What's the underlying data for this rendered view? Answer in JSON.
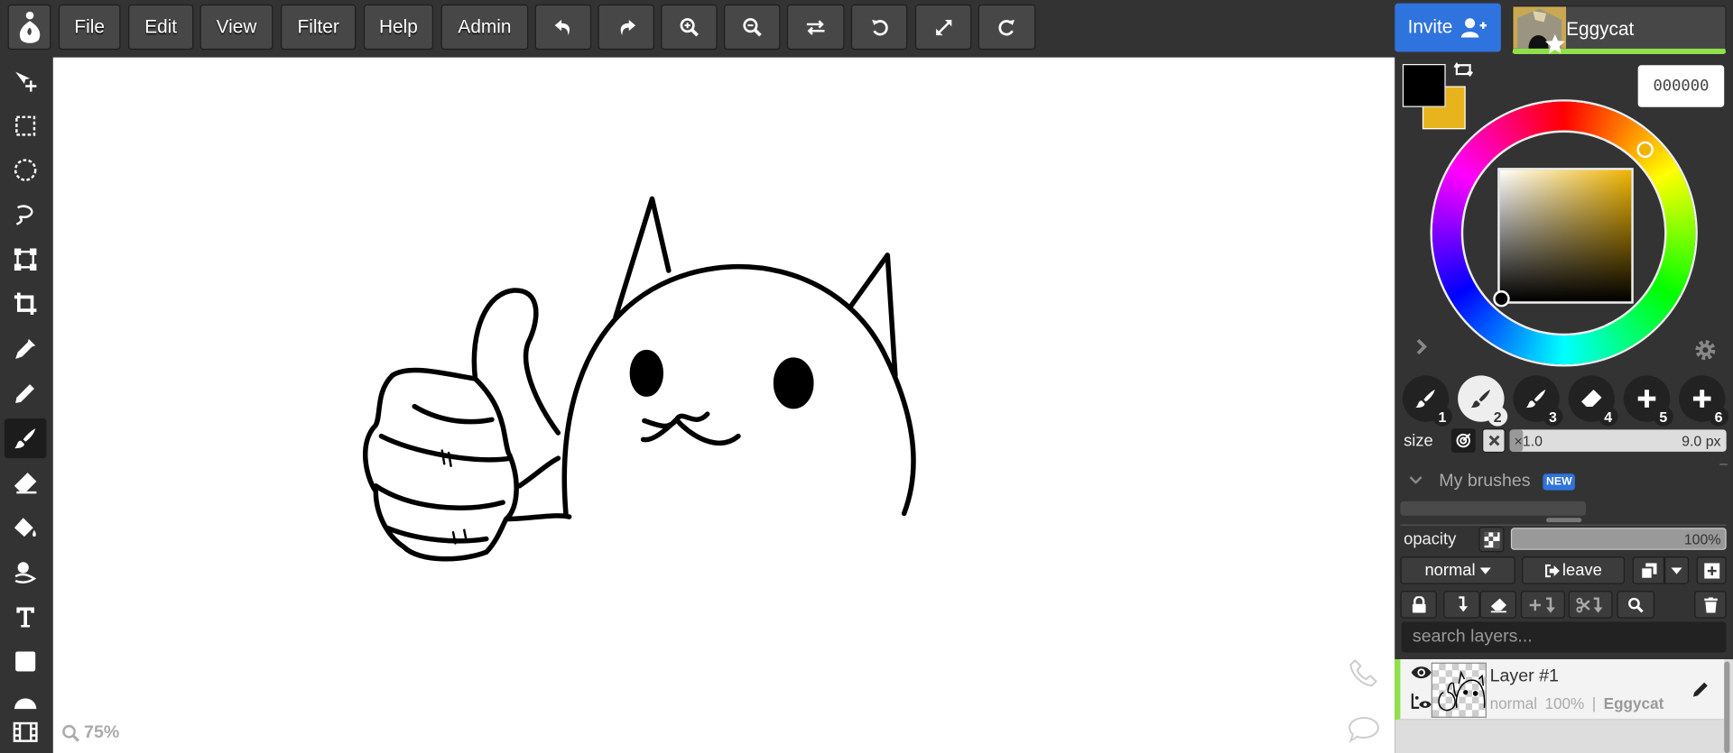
{
  "menu": {
    "file": "File",
    "edit": "Edit",
    "view": "View",
    "filter": "Filter",
    "help": "Help",
    "admin": "Admin"
  },
  "toolbar_icons": [
    "undo-icon",
    "redo-icon",
    "zoom-in-icon",
    "zoom-out-icon",
    "flip-icon",
    "rotate-icon",
    "fullscreen-icon",
    "reset-rotation-icon"
  ],
  "header": {
    "invite_label": "Invite",
    "username": "Eggycat"
  },
  "tools": [
    "move",
    "rect-select",
    "ellipse-select",
    "lasso",
    "transform",
    "crop",
    "eyedropper",
    "pencil",
    "brush",
    "eraser",
    "fill",
    "smudge",
    "text",
    "shape",
    "gradient",
    "timeline"
  ],
  "status": {
    "zoom": "75%"
  },
  "color": {
    "primary": "#000000",
    "secondary": "#e8b41e",
    "hex_value": "000000",
    "hue_color": "#f0b400"
  },
  "brushes": {
    "slots": [
      "1",
      "2",
      "3",
      "4",
      "5",
      "6"
    ],
    "active_slot": "2"
  },
  "size": {
    "label": "size",
    "multiplier": "×1.0",
    "value": "9.0 px"
  },
  "my_brushes": {
    "label": "My brushes",
    "badge": "NEW"
  },
  "opacity": {
    "label": "opacity",
    "value": "100%",
    "fraction": 1.0
  },
  "layer_controls": {
    "blend_mode": "normal",
    "leave_label": "leave",
    "search_placeholder": "search layers..."
  },
  "layers": [
    {
      "name": "Layer #1",
      "blend": "normal",
      "opacity": "100%",
      "owner": "Eggycat",
      "separator": "|"
    }
  ]
}
